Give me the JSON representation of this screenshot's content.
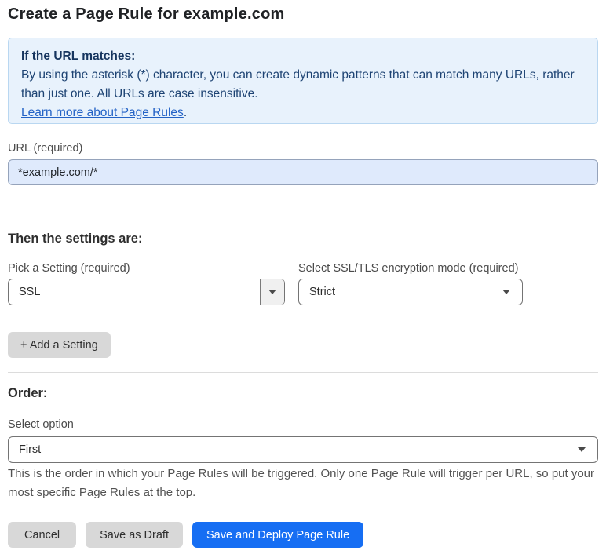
{
  "page": {
    "title": "Create a Page Rule for example.com"
  },
  "info_box": {
    "heading": "If the URL matches:",
    "body": "By using the asterisk (*) character, you can create dynamic patterns that can match many URLs, rather than just one. All URLs are case insensitive.",
    "link_label": "Learn more about Page Rules",
    "link_suffix": "."
  },
  "url_field": {
    "label": "URL (required)",
    "value": "*example.com/*"
  },
  "settings_section": {
    "heading": "Then the settings are:",
    "pick_setting": {
      "label": "Pick a Setting (required)",
      "value": "SSL"
    },
    "ssl_mode": {
      "label": "Select SSL/TLS encryption mode (required)",
      "value": "Strict"
    },
    "add_setting_label": "+ Add a Setting"
  },
  "order_section": {
    "heading": "Order:",
    "select_label": "Select option",
    "value": "First",
    "help_text": "This is the order in which your Page Rules will be triggered. Only one Page Rule will trigger per URL, so put your most specific Page Rules at the top."
  },
  "footer": {
    "cancel_label": "Cancel",
    "save_draft_label": "Save as Draft",
    "save_deploy_label": "Save and Deploy Page Rule"
  },
  "colors": {
    "accent_blue": "#166ef3",
    "info_bg": "#e8f2fc",
    "info_border": "#b9d7f1",
    "info_text": "#1d4373",
    "link_blue": "#2362c6",
    "input_bg": "#dfeafc",
    "button_gray": "#d8d8d8"
  },
  "icons": {
    "chevron_down": "caret-triangle"
  }
}
